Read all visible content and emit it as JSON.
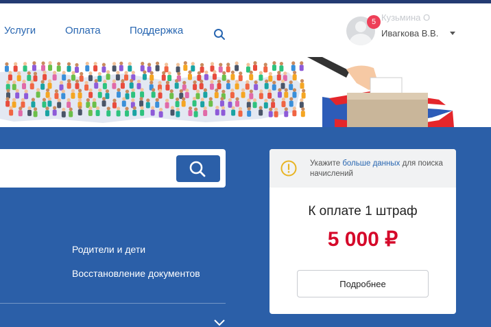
{
  "nav": {
    "items": [
      {
        "label": "Услуги"
      },
      {
        "label": "Оплата"
      },
      {
        "label": "Поддержка"
      }
    ]
  },
  "user": {
    "notifications": "5",
    "line1": "Кузьмина О",
    "line2": "Ивагкова В.В."
  },
  "search": {
    "value": "",
    "placeholder": ""
  },
  "categories": [
    {
      "label": "Родители и дети"
    },
    {
      "label": "Восстановление документов"
    }
  ],
  "payment_card": {
    "notice_prefix": "Укажите",
    "notice_link": "больше данных",
    "notice_suffix": "для поиска начислений",
    "title": "К оплате 1 штраф",
    "amount": "5 000 ₽",
    "details_button": "Подробнее"
  },
  "colors": {
    "brand_blue": "#2b5fa8",
    "link_blue": "#2866b1",
    "amount_red": "#d5092a",
    "badge_red": "#ee3f58",
    "warning_yellow": "#e8b423"
  },
  "icons": [
    "search-icon",
    "user-avatar-icon",
    "chevron-down-icon",
    "warning-icon"
  ]
}
